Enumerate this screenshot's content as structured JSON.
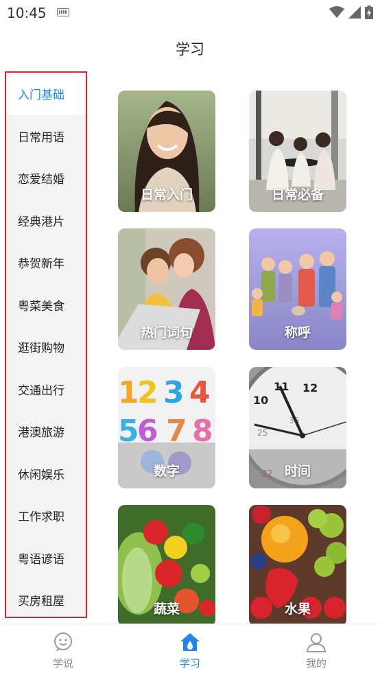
{
  "status_bar": {
    "time": "10:45"
  },
  "header": {
    "title": "学习"
  },
  "sidebar": {
    "items": [
      {
        "label": "入门基础",
        "active": true
      },
      {
        "label": "日常用语",
        "active": false
      },
      {
        "label": "恋爱结婚",
        "active": false
      },
      {
        "label": "经典港片",
        "active": false
      },
      {
        "label": "恭贺新年",
        "active": false
      },
      {
        "label": "粤菜美食",
        "active": false
      },
      {
        "label": "逛街购物",
        "active": false
      },
      {
        "label": "交通出行",
        "active": false
      },
      {
        "label": "港澳旅游",
        "active": false
      },
      {
        "label": "休闲娱乐",
        "active": false
      },
      {
        "label": "工作求职",
        "active": false
      },
      {
        "label": "粤语谚语",
        "active": false
      },
      {
        "label": "买房租屋",
        "active": false
      }
    ]
  },
  "cards": [
    {
      "label": "日常入门",
      "icon": "smiling-woman-photo"
    },
    {
      "label": "日常必备",
      "icon": "women-at-cafe-photo"
    },
    {
      "label": "热门词句",
      "icon": "two-women-laptop-photo"
    },
    {
      "label": "称呼",
      "icon": "family-illustration"
    },
    {
      "label": "数字",
      "icon": "colorful-numbers-image"
    },
    {
      "label": "时间",
      "icon": "clock-photo"
    },
    {
      "label": "蔬菜",
      "icon": "vegetables-photo"
    },
    {
      "label": "水果",
      "icon": "fruits-photo"
    }
  ],
  "bottom_nav": {
    "items": [
      {
        "label": "学说",
        "icon": "chat-smile-icon",
        "active": false
      },
      {
        "label": "学习",
        "icon": "home-drop-icon",
        "active": true
      },
      {
        "label": "我的",
        "icon": "user-icon",
        "active": false
      }
    ]
  },
  "colors": {
    "accent": "#1e88e5",
    "highlight_border": "#d9232d",
    "sidebar_bg": "#f4f4f4"
  }
}
